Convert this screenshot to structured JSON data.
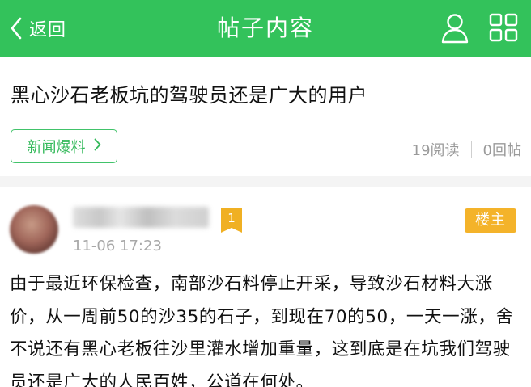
{
  "header": {
    "back_label": "返回",
    "title": "帖子内容",
    "back_icon": "chevron-left-icon",
    "user_icon": "user-icon",
    "grid_icon": "grid-icon",
    "accent_color": "#33c25b"
  },
  "post": {
    "title": "黑心沙石老板坑的驾驶员还是广大的用户",
    "category_label": "新闻爆料",
    "reads": "19阅读",
    "replies": "0回帖"
  },
  "reply": {
    "level": "1",
    "timestamp": "11-06 17:23",
    "op_label": "楼主",
    "content": "由于最近环保检查，南部沙石料停止开采，导致沙石材料大涨价，从一周前50的沙35的石子，到现在70的50，一天一涨，舍不说还有黑心老板往沙里灌水增加重量，这到底是在坑我们驾驶员还是广大的人民百姓，公道在何处。",
    "badge_color": "#f4b32a"
  }
}
